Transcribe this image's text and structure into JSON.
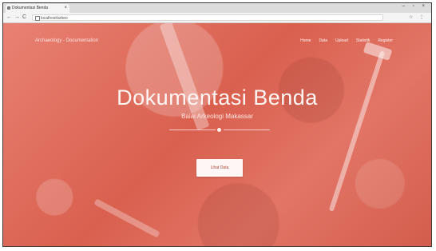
{
  "browser": {
    "tab_title": "Dokumentasi Benda",
    "tab_close": "×",
    "window_controls": "– ▫ ×",
    "back": "←",
    "forward": "→",
    "reload": "C",
    "address": "localhost/arkeo",
    "ext": "☆ ⋮"
  },
  "header": {
    "brand": "Archaeology - Documentation",
    "nav": [
      "Home",
      "Data",
      "Upload",
      "Statistik",
      "Register"
    ]
  },
  "hero": {
    "title": "Dokumentasi Benda",
    "subtitle": "Balai Arkeologi Makassar",
    "cta_label": "Lihat Data"
  },
  "colors": {
    "hero_tint": "#d9604f",
    "text_light": "#fff6f4"
  }
}
